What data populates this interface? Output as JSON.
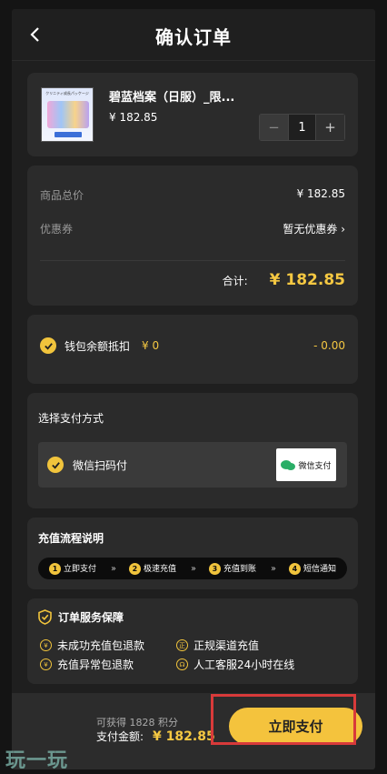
{
  "header": {
    "title": "确认订单"
  },
  "product": {
    "name": "碧蓝档案（日服）_限...",
    "price": "¥ 182.85",
    "quantity": "1",
    "image_caption": "クリニティ成長パッケージ"
  },
  "summary": {
    "total_label": "商品总价",
    "total_value": "¥ 182.85",
    "coupon_label": "优惠券",
    "coupon_value": "暂无优惠券",
    "sum_label": "合计:",
    "sum_value": "¥ 182.85"
  },
  "wallet": {
    "label": "钱包余额抵扣",
    "balance": "¥ 0",
    "deduction": "- 0.00"
  },
  "payment": {
    "section_title": "选择支付方式",
    "option_label": "微信扫码付",
    "logo_text": "微信支付"
  },
  "flow": {
    "title": "充值流程说明",
    "steps": [
      {
        "num": "1",
        "label": "立即支付"
      },
      {
        "num": "2",
        "label": "极速充值"
      },
      {
        "num": "3",
        "label": "充值到账"
      },
      {
        "num": "4",
        "label": "短信通知"
      }
    ]
  },
  "guarantee": {
    "title": "订单服务保障",
    "items": [
      "未成功充值包退款",
      "正规渠道充值",
      "充值异常包退款",
      "人工客服24小时在线"
    ]
  },
  "footer": {
    "points": "可获得 1828 积分",
    "amount_label": "支付金额:",
    "amount_value": "¥ 182.85",
    "pay_button": "立即支付"
  },
  "watermark": "玩一玩",
  "colors": {
    "accent": "#f4c33d",
    "highlight": "#d83a3a",
    "background": "#1f1f1f",
    "card": "#2b2b2b"
  }
}
